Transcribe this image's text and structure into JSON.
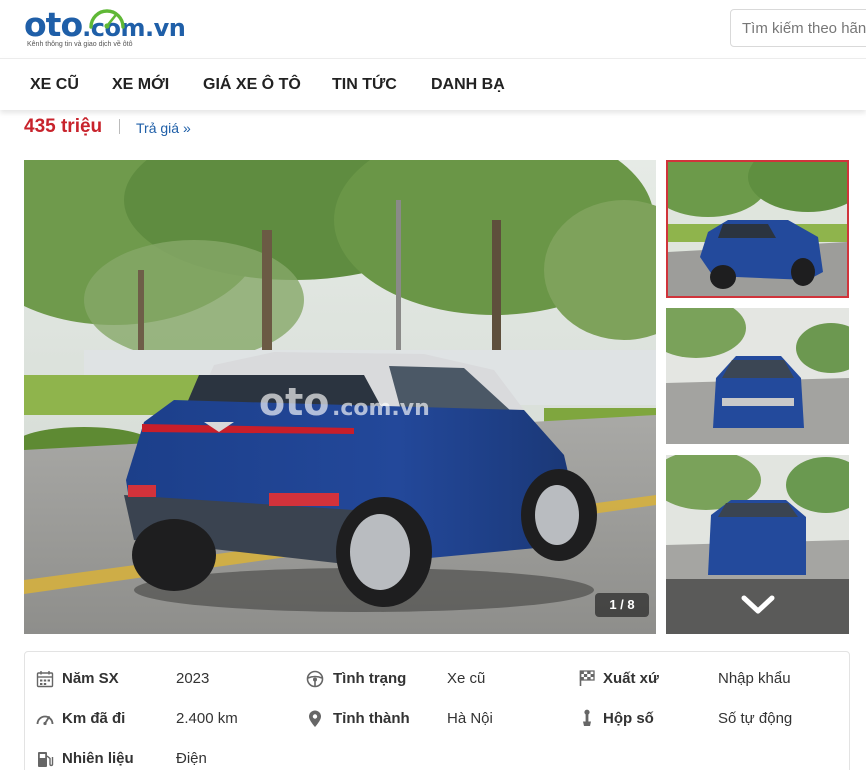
{
  "header": {
    "logo_text_main": "oto",
    "logo_text_domain": ".com.vn",
    "logo_tagline": "Kênh thông tin và giao dịch về ôtô",
    "search_placeholder": "Tìm kiếm theo hãng"
  },
  "nav": {
    "items": [
      {
        "label": "XE CŨ"
      },
      {
        "label": "XE MỚI"
      },
      {
        "label": "GIÁ XE Ô TÔ"
      },
      {
        "label": "TIN TỨC"
      },
      {
        "label": "DANH BẠ"
      }
    ]
  },
  "listing": {
    "price": "435 triệu",
    "bid_label": "Trả giá »",
    "photo_counter": "1 / 8"
  },
  "specs": {
    "rows": [
      [
        {
          "icon": "calendar-icon",
          "label": "Năm SX",
          "value": "2023"
        },
        {
          "icon": "steering-wheel-icon",
          "label": "Tình trạng",
          "value": "Xe cũ"
        },
        {
          "icon": "flag-icon",
          "label": "Xuất xứ",
          "value": "Nhập khẩu"
        }
      ],
      [
        {
          "icon": "speedometer-icon",
          "label": "Km đã đi",
          "value": "2.400 km"
        },
        {
          "icon": "location-pin-icon",
          "label": "Tỉnh thành",
          "value": "Hà Nội"
        },
        {
          "icon": "gear-shift-icon",
          "label": "Hộp số",
          "value": "Số tự động"
        }
      ],
      [
        {
          "icon": "fuel-pump-icon",
          "label": "Nhiên liệu",
          "value": "Điện"
        }
      ]
    ]
  },
  "colors": {
    "brand_blue": "#1f5fa8",
    "price_red": "#c8232c",
    "logo_green": "#5fb836",
    "active_thumb_border": "#d0343b"
  }
}
